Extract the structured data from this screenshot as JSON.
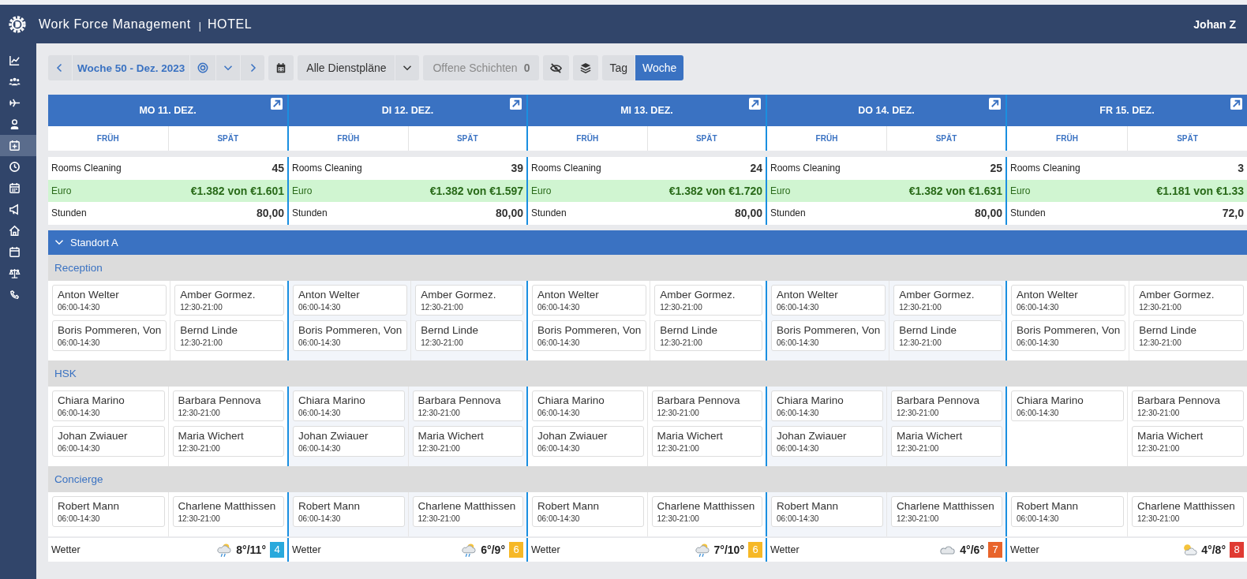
{
  "header": {
    "title": "Work Force Management",
    "separator": "|",
    "subtitle": "HOTEL",
    "user": "Johan Z"
  },
  "sidebar": {
    "items": [
      {
        "kind": "chart",
        "selected": false
      },
      {
        "kind": "users",
        "selected": false
      },
      {
        "kind": "plane",
        "selected": false
      },
      {
        "kind": "person",
        "selected": false
      },
      {
        "kind": "calendar-plus",
        "selected": true
      },
      {
        "kind": "clock",
        "selected": false
      },
      {
        "kind": "calendar",
        "selected": false
      },
      {
        "kind": "megaphone",
        "selected": false
      },
      {
        "kind": "home",
        "selected": false
      },
      {
        "kind": "calendar-blank",
        "selected": false
      },
      {
        "kind": "scales",
        "selected": false
      },
      {
        "kind": "phone",
        "selected": false
      }
    ]
  },
  "toolbar": {
    "week_label": "Woche 50 - Dez. 2023",
    "roster_select": "Alle Dienstpläne",
    "open_shifts": {
      "label": "Offene Schichten",
      "count": "0",
      "disabled": true
    },
    "views": [
      {
        "label": "Tag",
        "selected": false
      },
      {
        "label": "Woche",
        "selected": true
      }
    ]
  },
  "days": [
    {
      "label": "MO 11. DEZ.",
      "shifts": [
        "FRÜH",
        "SPÄT"
      ],
      "stats": [
        {
          "kind": "count",
          "label": "Rooms Cleaning",
          "value": "45"
        },
        {
          "kind": "budget",
          "label": "Euro",
          "value": "€1.382 von €1.601"
        },
        {
          "kind": "count",
          "label": "Stunden",
          "value": "80,00"
        }
      ],
      "weather": {
        "label": "Wetter",
        "kind": "rain",
        "temp": "8°/11°",
        "index": "4",
        "color": "#29a9dc"
      }
    },
    {
      "label": "DI 12. DEZ.",
      "shifts": [
        "FRÜH",
        "SPÄT"
      ],
      "stats": [
        {
          "kind": "count",
          "label": "Rooms Cleaning",
          "value": "39"
        },
        {
          "kind": "budget",
          "label": "Euro",
          "value": "€1.382 von €1.597"
        },
        {
          "kind": "count",
          "label": "Stunden",
          "value": "80,00"
        }
      ],
      "weather": {
        "label": "Wetter",
        "kind": "rain",
        "temp": "6°/9°",
        "index": "6",
        "color": "#f6b826"
      }
    },
    {
      "label": "MI 13. DEZ.",
      "shifts": [
        "FRÜH",
        "SPÄT"
      ],
      "stats": [
        {
          "kind": "count",
          "label": "Rooms Cleaning",
          "value": "24"
        },
        {
          "kind": "budget",
          "label": "Euro",
          "value": "€1.382 von €1.720"
        },
        {
          "kind": "count",
          "label": "Stunden",
          "value": "80,00"
        }
      ],
      "weather": {
        "label": "Wetter",
        "kind": "rain",
        "temp": "7°/10°",
        "index": "6",
        "color": "#f6b826"
      }
    },
    {
      "label": "DO 14. DEZ.",
      "shifts": [
        "FRÜH",
        "SPÄT"
      ],
      "stats": [
        {
          "kind": "count",
          "label": "Rooms Cleaning",
          "value": "25"
        },
        {
          "kind": "budget",
          "label": "Euro",
          "value": "€1.382 von €1.631"
        },
        {
          "kind": "count",
          "label": "Stunden",
          "value": "80,00"
        }
      ],
      "weather": {
        "label": "Wetter",
        "kind": "cloud",
        "temp": "4°/6°",
        "index": "7",
        "color": "#e8642b"
      }
    },
    {
      "label": "FR 15. DEZ.",
      "shifts": [
        "FRÜH",
        "SPÄT"
      ],
      "stats": [
        {
          "kind": "count",
          "label": "Rooms Cleaning",
          "value": "3"
        },
        {
          "kind": "budget",
          "label": "Euro",
          "value": "€1.181 von €1.33"
        },
        {
          "kind": "count",
          "label": "Stunden",
          "value": "72,0"
        }
      ],
      "weather": {
        "label": "Wetter",
        "kind": "partly",
        "temp": "4°/8°",
        "index": "8",
        "color": "#e03a32"
      }
    }
  ],
  "location": {
    "name": "Standort A",
    "expanded": true,
    "groups": [
      {
        "name": "Reception",
        "days": [
          {
            "early": [
              {
                "name": "Anton Welter",
                "time": "06:00-14:30"
              },
              {
                "name": "Boris Pommeren, Von",
                "time": "06:00-14:30"
              }
            ],
            "late": [
              {
                "name": "Amber Gormez.",
                "time": "12:30-21:00"
              },
              {
                "name": "Bernd Linde",
                "time": "12:30-21:00"
              }
            ]
          },
          {
            "early": [
              {
                "name": "Anton Welter",
                "time": "06:00-14:30"
              },
              {
                "name": "Boris Pommeren, Von",
                "time": "06:00-14:30"
              }
            ],
            "late": [
              {
                "name": "Amber Gormez.",
                "time": "12:30-21:00"
              },
              {
                "name": "Bernd Linde",
                "time": "12:30-21:00"
              }
            ]
          },
          {
            "early": [
              {
                "name": "Anton Welter",
                "time": "06:00-14:30"
              },
              {
                "name": "Boris Pommeren, Von",
                "time": "06:00-14:30"
              }
            ],
            "late": [
              {
                "name": "Amber Gormez.",
                "time": "12:30-21:00"
              },
              {
                "name": "Bernd Linde",
                "time": "12:30-21:00"
              }
            ]
          },
          {
            "early": [
              {
                "name": "Anton Welter",
                "time": "06:00-14:30"
              },
              {
                "name": "Boris Pommeren, Von",
                "time": "06:00-14:30"
              }
            ],
            "late": [
              {
                "name": "Amber Gormez.",
                "time": "12:30-21:00"
              },
              {
                "name": "Bernd Linde",
                "time": "12:30-21:00"
              }
            ]
          },
          {
            "early": [
              {
                "name": "Anton Welter",
                "time": "06:00-14:30"
              },
              {
                "name": "Boris Pommeren, Von",
                "time": "06:00-14:30"
              }
            ],
            "late": [
              {
                "name": "Amber Gormez.",
                "time": "12:30-21:00"
              },
              {
                "name": "Bernd Linde",
                "time": "12:30-21:00"
              }
            ]
          }
        ]
      },
      {
        "name": "HSK",
        "days": [
          {
            "early": [
              {
                "name": "Chiara Marino",
                "time": "06:00-14:30"
              },
              {
                "name": "Johan Zwiauer",
                "time": "06:00-14:30"
              }
            ],
            "late": [
              {
                "name": "Barbara Pennova",
                "time": "12:30-21:00"
              },
              {
                "name": "Maria Wichert",
                "time": "12:30-21:00"
              }
            ]
          },
          {
            "early": [
              {
                "name": "Chiara Marino",
                "time": "06:00-14:30"
              },
              {
                "name": "Johan Zwiauer",
                "time": "06:00-14:30"
              }
            ],
            "late": [
              {
                "name": "Barbara Pennova",
                "time": "12:30-21:00"
              },
              {
                "name": "Maria Wichert",
                "time": "12:30-21:00"
              }
            ]
          },
          {
            "early": [
              {
                "name": "Chiara Marino",
                "time": "06:00-14:30"
              },
              {
                "name": "Johan Zwiauer",
                "time": "06:00-14:30"
              }
            ],
            "late": [
              {
                "name": "Barbara Pennova",
                "time": "12:30-21:00"
              },
              {
                "name": "Maria Wichert",
                "time": "12:30-21:00"
              }
            ]
          },
          {
            "early": [
              {
                "name": "Chiara Marino",
                "time": "06:00-14:30"
              },
              {
                "name": "Johan Zwiauer",
                "time": "06:00-14:30"
              }
            ],
            "late": [
              {
                "name": "Barbara Pennova",
                "time": "12:30-21:00"
              },
              {
                "name": "Maria Wichert",
                "time": "12:30-21:00"
              }
            ]
          },
          {
            "early": [
              {
                "name": "Chiara Marino",
                "time": "06:00-14:30"
              }
            ],
            "late": [
              {
                "name": "Barbara Pennova",
                "time": "12:30-21:00"
              },
              {
                "name": "Maria Wichert",
                "time": "12:30-21:00"
              }
            ]
          }
        ]
      },
      {
        "name": "Concierge",
        "days": [
          {
            "early": [
              {
                "name": "Robert Mann",
                "time": "06:00-14:30"
              }
            ],
            "late": [
              {
                "name": "Charlene Matthissen",
                "time": "12:30-21:00"
              }
            ]
          },
          {
            "early": [
              {
                "name": "Robert Mann",
                "time": "06:00-14:30"
              }
            ],
            "late": [
              {
                "name": "Charlene Matthissen",
                "time": "12:30-21:00"
              }
            ]
          },
          {
            "early": [
              {
                "name": "Robert Mann",
                "time": "06:00-14:30"
              }
            ],
            "late": [
              {
                "name": "Charlene Matthissen",
                "time": "12:30-21:00"
              }
            ]
          },
          {
            "early": [
              {
                "name": "Robert Mann",
                "time": "06:00-14:30"
              }
            ],
            "late": [
              {
                "name": "Charlene Matthissen",
                "time": "12:30-21:00"
              }
            ]
          },
          {
            "early": [
              {
                "name": "Robert Mann",
                "time": "06:00-14:30"
              }
            ],
            "late": [
              {
                "name": "Charlene Matthissen",
                "time": "12:30-21:00"
              }
            ]
          }
        ]
      }
    ]
  }
}
